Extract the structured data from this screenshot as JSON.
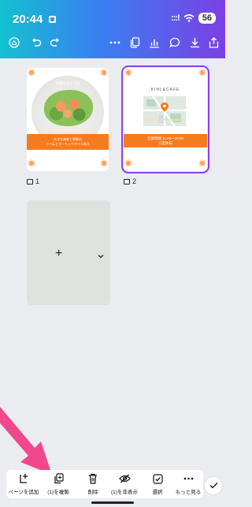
{
  "status": {
    "time": "20:44",
    "signal": ":::!",
    "battery": "56"
  },
  "toolbar": {
    "icons": [
      "home-icon",
      "undo-icon",
      "redo-icon",
      "more-icon",
      "pages-icon",
      "chart-icon",
      "comment-icon",
      "download-icon",
      "share-icon"
    ]
  },
  "pages": [
    {
      "number": "1",
      "title": "季節のおすすめ",
      "band_text_1": "大きな海老と季節の",
      "band_text_2": "ライムとガーリックオイル和え"
    },
    {
      "number": "2",
      "brand": "KIHL&CAFE",
      "band_text_1": "営業時間 11:00～20:00",
      "band_text_2": "◎定休日"
    }
  ],
  "add_page": {
    "plus": "+"
  },
  "actions": [
    {
      "label": "ページを追加",
      "icon": "add-page-icon"
    },
    {
      "label": "(1)を複製",
      "icon": "duplicate-icon"
    },
    {
      "label": "削除",
      "icon": "trash-icon"
    },
    {
      "label": "(1)を非表示",
      "icon": "hide-icon"
    },
    {
      "label": "選択",
      "icon": "select-icon"
    },
    {
      "label": "もっと見る",
      "icon": "more-icon"
    }
  ],
  "colors": {
    "accent": "#8b3dff",
    "orange": "#f57b1f",
    "arrow": "#f0488e"
  }
}
